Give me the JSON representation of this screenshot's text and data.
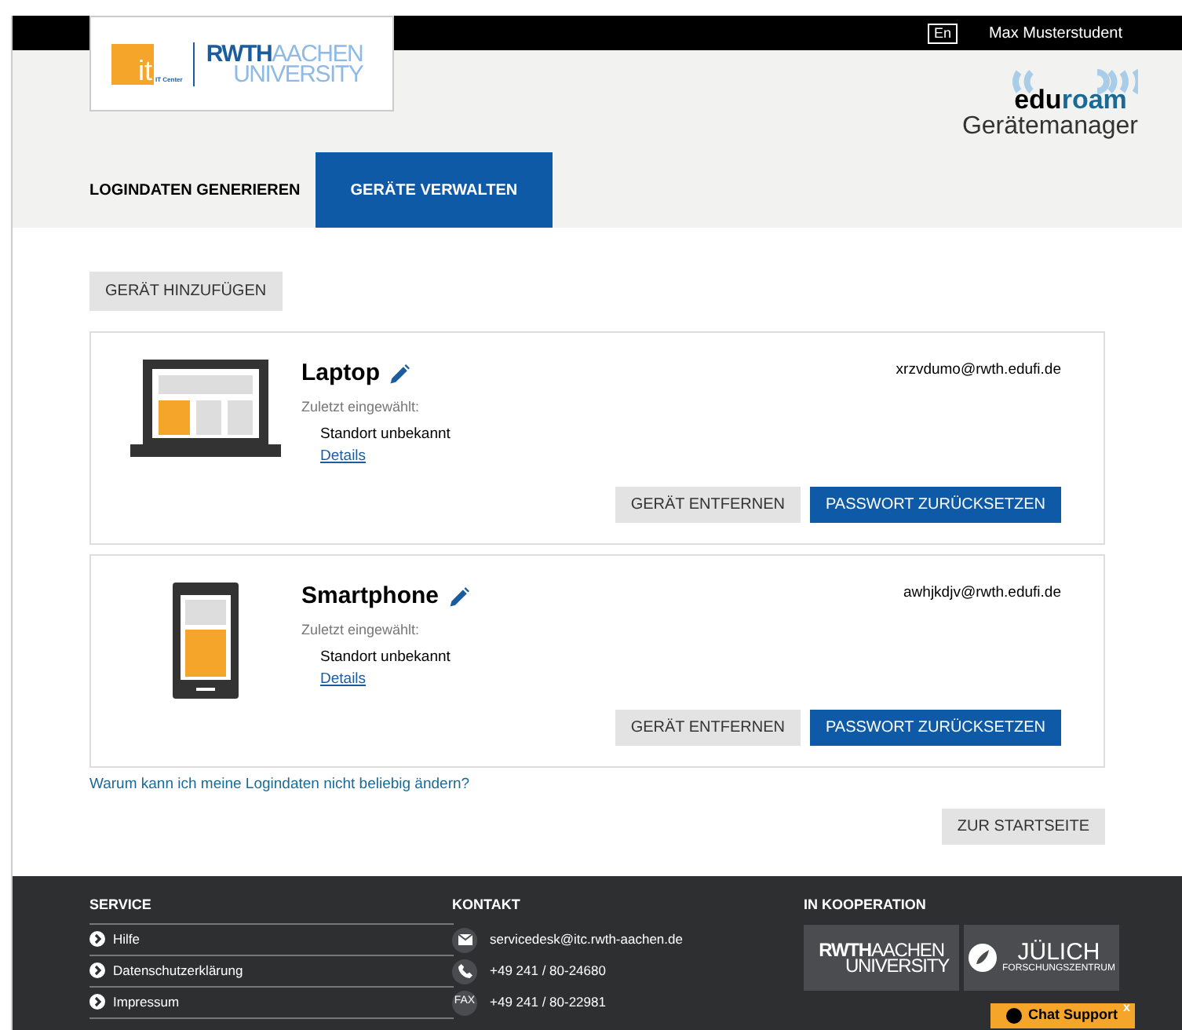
{
  "top_bar": {
    "language": "En",
    "user": "Max Musterstudent"
  },
  "header": {
    "logo": {
      "it": "it",
      "it_label": "IT Center",
      "rwth": "RWTH",
      "aachen": "AACHEN",
      "university": "UNIVERSITY"
    },
    "brand": {
      "edu": "edu",
      "roam": "roam",
      "subtitle": "Gerätemanager"
    }
  },
  "tabs": [
    {
      "label": "LOGINDATEN GENERIEREN",
      "selected": false
    },
    {
      "label": "GERÄTE VERWALTEN",
      "selected": true
    }
  ],
  "add_button": "GERÄT HINZUFÜGEN",
  "devices": [
    {
      "kind": "laptop",
      "name": "Laptop",
      "last_label": "Zuletzt eingewählt:",
      "location": "Standort unbekannt",
      "details": "Details",
      "account": "xrzvdumo@rwth.edufi.de",
      "remove": "GERÄT ENTFERNEN",
      "reset": "PASSWORT ZURÜCKSETZEN"
    },
    {
      "kind": "phone",
      "name": "Smartphone",
      "last_label": "Zuletzt eingewählt:",
      "location": "Standort unbekannt",
      "details": "Details",
      "account": "awhjkdjv@rwth.edufi.de",
      "remove": "GERÄT ENTFERNEN",
      "reset": "PASSWORT ZURÜCKSETZEN"
    }
  ],
  "help_link": "Warum kann ich meine Logindaten nicht beliebig ändern?",
  "home_button": "ZUR STARTSEITE",
  "footer": {
    "service": {
      "title": "SERVICE",
      "links": [
        "Hilfe",
        "Datenschutzerklärung",
        "Impressum"
      ]
    },
    "contact": {
      "title": "KONTAKT",
      "items": [
        {
          "kind": "mail",
          "text": "servicedesk@itc.rwth-aachen.de"
        },
        {
          "kind": "phone",
          "text": "+49 241 / 80-24680"
        },
        {
          "kind": "fax",
          "icon_text": "FAX",
          "text": "+49 241 / 80-22981"
        }
      ]
    },
    "cooperation": {
      "title": "IN KOOPERATION",
      "rwth": "RWTH",
      "aachen": "AACHEN",
      "university": "UNIVERSITY",
      "juelich": "JÜLICH",
      "juelich_sub": "FORSCHUNGSZENTRUM"
    }
  },
  "chat": {
    "label": "Chat Support",
    "close": "x"
  }
}
